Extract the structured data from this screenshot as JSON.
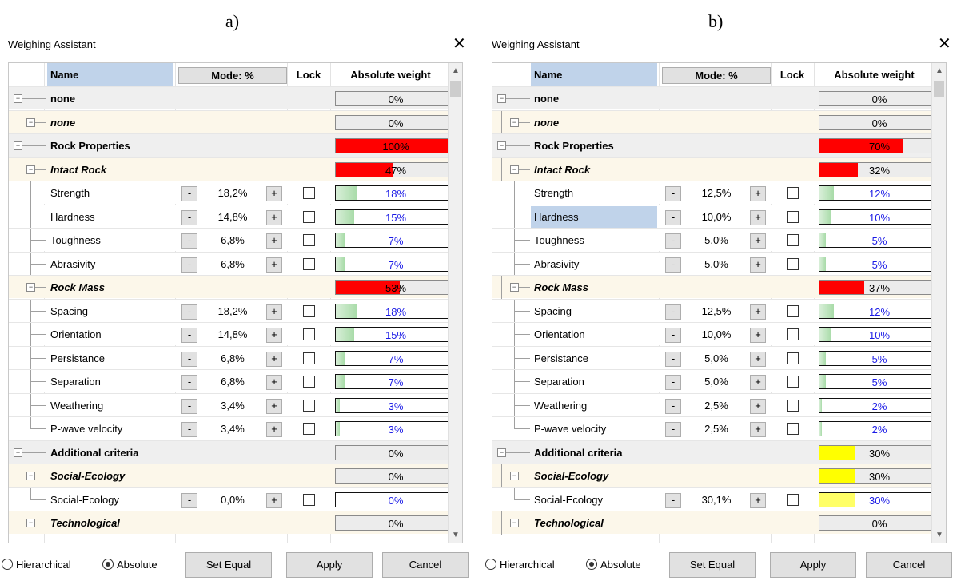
{
  "panels": [
    {
      "caption": "a)",
      "title": "Weighing Assistant",
      "columns": {
        "name": "Name",
        "mode": "Mode: %",
        "lock": "Lock",
        "absolute": "Absolute weight"
      },
      "rows": [
        {
          "name": "none",
          "level": 0,
          "abs": "0%",
          "fill": 0,
          "color": "#ff0000"
        },
        {
          "name": "none",
          "level": 1,
          "abs": "0%",
          "fill": 0,
          "color": "#ff0000"
        },
        {
          "name": "Rock Properties",
          "level": 0,
          "abs": "100%",
          "fill": 1.0,
          "color": "#ff0000"
        },
        {
          "name": "Intact Rock",
          "level": 1,
          "abs": "47%",
          "fill": 0.47,
          "color": "#ff0000"
        },
        {
          "name": "Strength",
          "level": 2,
          "pct": "18,2%",
          "abs": "18%",
          "fill": 0.18
        },
        {
          "name": "Hardness",
          "level": 2,
          "pct": "14,8%",
          "abs": "15%",
          "fill": 0.15
        },
        {
          "name": "Toughness",
          "level": 2,
          "pct": "6,8%",
          "abs": "7%",
          "fill": 0.07
        },
        {
          "name": "Abrasivity",
          "level": 2,
          "pct": "6,8%",
          "abs": "7%",
          "fill": 0.07
        },
        {
          "name": "Rock Mass",
          "level": 1,
          "abs": "53%",
          "fill": 0.53,
          "color": "#ff0000"
        },
        {
          "name": "Spacing",
          "level": 2,
          "pct": "18,2%",
          "abs": "18%",
          "fill": 0.18
        },
        {
          "name": "Orientation",
          "level": 2,
          "pct": "14,8%",
          "abs": "15%",
          "fill": 0.15
        },
        {
          "name": "Persistance",
          "level": 2,
          "pct": "6,8%",
          "abs": "7%",
          "fill": 0.07
        },
        {
          "name": "Separation",
          "level": 2,
          "pct": "6,8%",
          "abs": "7%",
          "fill": 0.07
        },
        {
          "name": "Weathering",
          "level": 2,
          "pct": "3,4%",
          "abs": "3%",
          "fill": 0.03
        },
        {
          "name": "P-wave velocity",
          "level": 2,
          "pct": "3,4%",
          "abs": "3%",
          "fill": 0.03,
          "last": true
        },
        {
          "name": "Additional criteria",
          "level": 0,
          "abs": "0%",
          "fill": 0,
          "color": "#ffff00"
        },
        {
          "name": "Social-Ecology",
          "level": 1,
          "abs": "0%",
          "fill": 0,
          "color": "#ffff00"
        },
        {
          "name": "Social-Ecology",
          "level": 2,
          "pct": "0,0%",
          "abs": "0%",
          "fill": 0,
          "last": true
        },
        {
          "name": "Technological",
          "level": 1,
          "abs": "0%",
          "fill": 0,
          "color": "#ffff00"
        }
      ],
      "radio": {
        "hierarchical": "Hierarchical",
        "absolute": "Absolute",
        "selected": "absolute"
      },
      "buttons": {
        "set_equal": "Set Equal",
        "apply": "Apply",
        "cancel": "Cancel"
      }
    },
    {
      "caption": "b)",
      "title": "Weighing Assistant",
      "columns": {
        "name": "Name",
        "mode": "Mode: %",
        "lock": "Lock",
        "absolute": "Absolute weight"
      },
      "rows": [
        {
          "name": "none",
          "level": 0,
          "abs": "0%",
          "fill": 0,
          "color": "#ff0000"
        },
        {
          "name": "none",
          "level": 1,
          "abs": "0%",
          "fill": 0,
          "color": "#ff0000"
        },
        {
          "name": "Rock Properties",
          "level": 0,
          "abs": "70%",
          "fill": 0.7,
          "color": "#ff0000"
        },
        {
          "name": "Intact Rock",
          "level": 1,
          "abs": "32%",
          "fill": 0.32,
          "color": "#ff0000"
        },
        {
          "name": "Strength",
          "level": 2,
          "pct": "12,5%",
          "abs": "12%",
          "fill": 0.12
        },
        {
          "name": "Hardness",
          "level": 2,
          "pct": "10,0%",
          "abs": "10%",
          "fill": 0.1,
          "selected": true
        },
        {
          "name": "Toughness",
          "level": 2,
          "pct": "5,0%",
          "abs": "5%",
          "fill": 0.05
        },
        {
          "name": "Abrasivity",
          "level": 2,
          "pct": "5,0%",
          "abs": "5%",
          "fill": 0.05
        },
        {
          "name": "Rock Mass",
          "level": 1,
          "abs": "37%",
          "fill": 0.37,
          "color": "#ff0000"
        },
        {
          "name": "Spacing",
          "level": 2,
          "pct": "12,5%",
          "abs": "12%",
          "fill": 0.12
        },
        {
          "name": "Orientation",
          "level": 2,
          "pct": "10,0%",
          "abs": "10%",
          "fill": 0.1
        },
        {
          "name": "Persistance",
          "level": 2,
          "pct": "5,0%",
          "abs": "5%",
          "fill": 0.05
        },
        {
          "name": "Separation",
          "level": 2,
          "pct": "5,0%",
          "abs": "5%",
          "fill": 0.05
        },
        {
          "name": "Weathering",
          "level": 2,
          "pct": "2,5%",
          "abs": "2%",
          "fill": 0.02
        },
        {
          "name": "P-wave velocity",
          "level": 2,
          "pct": "2,5%",
          "abs": "2%",
          "fill": 0.02,
          "last": true
        },
        {
          "name": "Additional criteria",
          "level": 0,
          "abs": "30%",
          "fill": 0.3,
          "color": "#ffff00"
        },
        {
          "name": "Social-Ecology",
          "level": 1,
          "abs": "30%",
          "fill": 0.3,
          "color": "#ffff00"
        },
        {
          "name": "Social-Ecology",
          "level": 2,
          "pct": "30,1%",
          "abs": "30%",
          "fill": 0.3,
          "color": "#ffff00",
          "last": true
        },
        {
          "name": "Technological",
          "level": 1,
          "abs": "0%",
          "fill": 0,
          "color": "#ffff00"
        }
      ],
      "radio": {
        "hierarchical": "Hierarchical",
        "absolute": "Absolute",
        "selected": "absolute"
      },
      "buttons": {
        "set_equal": "Set Equal",
        "apply": "Apply",
        "cancel": "Cancel"
      }
    }
  ],
  "icons": {
    "close": "close-icon",
    "expand": "collapse-tree-icon",
    "scroll_up": "scroll-up-icon",
    "scroll_down": "scroll-down-icon"
  },
  "colors": {
    "header_bg": "#c0d3ea",
    "group_row": "#efefef",
    "subgroup_row": "#fcf7ea",
    "leaf_bar": "#bfe3bf",
    "leaf_text": "#1a1ae6"
  }
}
